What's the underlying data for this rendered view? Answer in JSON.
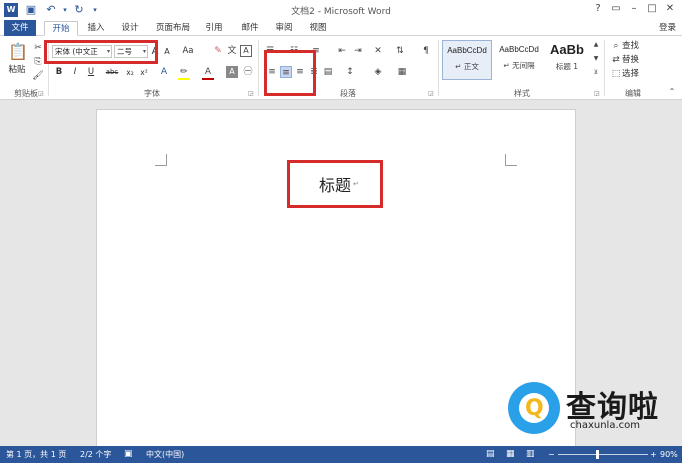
{
  "window": {
    "title": "文档2 - Microsoft Word",
    "login": "登录",
    "controls": [
      "?",
      "▭",
      "–",
      "□",
      "✕"
    ]
  },
  "tabs": [
    {
      "label": "文件"
    },
    {
      "label": "开始"
    },
    {
      "label": "插入"
    },
    {
      "label": "设计"
    },
    {
      "label": "页面布局"
    },
    {
      "label": "引用"
    },
    {
      "label": "邮件"
    },
    {
      "label": "审阅"
    },
    {
      "label": "视图"
    }
  ],
  "ribbon": {
    "clipboard": {
      "paste_label": "粘贴",
      "group_label": "剪贴板"
    },
    "font": {
      "font_name": "宋体 (中文正",
      "font_size": "二号",
      "group_label": "字体",
      "bold": "B",
      "italic": "I",
      "underline": "U",
      "strike": "abc",
      "subscript": "x₂",
      "superscript": "x²",
      "grow": "A",
      "shrink": "A",
      "case": "Aa",
      "font_color_accent": "#c00000",
      "highlight_accent": "#ffff00"
    },
    "paragraph": {
      "group_label": "段落"
    },
    "styles": {
      "group_label": "样式",
      "items": [
        {
          "sample": "AaBbCcDd",
          "name": "↵ 正文"
        },
        {
          "sample": "AaBbCcDd",
          "name": "↵ 无间隔"
        },
        {
          "sample": "AaBb",
          "name": "标题 1"
        }
      ]
    },
    "editing": {
      "group_label": "编辑",
      "find": "查找",
      "replace": "替换",
      "select": "选择"
    }
  },
  "document": {
    "heading": "标题",
    "para_mark": "↵"
  },
  "status": {
    "page": "第 1 页，共 1 页",
    "words": "2/2 个字",
    "language": "中文(中国)",
    "zoom": "90%",
    "zoom_minus": "−",
    "zoom_plus": "+"
  },
  "watermark": {
    "logo_letter": "Q",
    "title": "查询啦",
    "url": "chaxunla.com"
  },
  "colors": {
    "brand": "#2b579a",
    "highlight_box": "#d62b2b"
  }
}
